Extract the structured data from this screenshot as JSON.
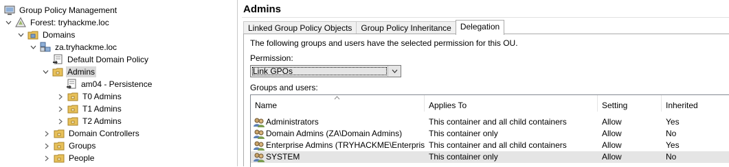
{
  "tree": {
    "root": {
      "label": "Group Policy Management",
      "icon": "gpm-console-icon"
    },
    "forest": {
      "label": "Forest: tryhackme.loc",
      "icon": "forest-icon"
    },
    "domains": {
      "label": "Domains",
      "icon": "domains-folder-icon"
    },
    "domain": {
      "label": "za.tryhackme.loc",
      "icon": "domain-icon"
    },
    "items": [
      {
        "label": "Default Domain Policy",
        "icon": "gpo-link-icon"
      },
      {
        "label": "Admins",
        "icon": "ou-folder-icon"
      },
      {
        "label": "am04 - Persistence",
        "icon": "gpo-link-icon"
      },
      {
        "label": "T0 Admins",
        "icon": "ou-folder-icon"
      },
      {
        "label": "T1 Admins",
        "icon": "ou-folder-icon"
      },
      {
        "label": "T2 Admins",
        "icon": "ou-folder-icon"
      },
      {
        "label": "Domain Controllers",
        "icon": "ou-folder-icon"
      },
      {
        "label": "Groups",
        "icon": "ou-folder-icon"
      },
      {
        "label": "People",
        "icon": "ou-folder-icon"
      }
    ],
    "selected": "Admins"
  },
  "pane": {
    "title": "Admins",
    "tabs": [
      {
        "label": "Linked Group Policy Objects",
        "active": false
      },
      {
        "label": "Group Policy Inheritance",
        "active": false
      },
      {
        "label": "Delegation",
        "active": true
      }
    ],
    "description": "The following groups and users have the selected permission for this OU.",
    "permission_label": "Permission:",
    "permission_value": "Link GPOs",
    "groups_label": "Groups and users:",
    "columns": [
      "Name",
      "Applies To",
      "Setting",
      "Inherited"
    ],
    "rows": [
      {
        "name": "Administrators",
        "applies": "This container and all child containers",
        "setting": "Allow",
        "inherited": "Yes"
      },
      {
        "name": "Domain Admins (ZA\\Domain Admins)",
        "applies": "This container only",
        "setting": "Allow",
        "inherited": "No"
      },
      {
        "name": "Enterprise Admins (TRYHACKME\\Enterprise A...",
        "applies": "This container and all child containers",
        "setting": "Allow",
        "inherited": "Yes"
      },
      {
        "name": "SYSTEM",
        "applies": "This container only",
        "setting": "Allow",
        "inherited": "No"
      }
    ],
    "selected_row": "SYSTEM"
  },
  "colors": {
    "selection": "#d9d9d9",
    "tab_border": "#aaaaaa",
    "folder": "#e8c15a"
  }
}
